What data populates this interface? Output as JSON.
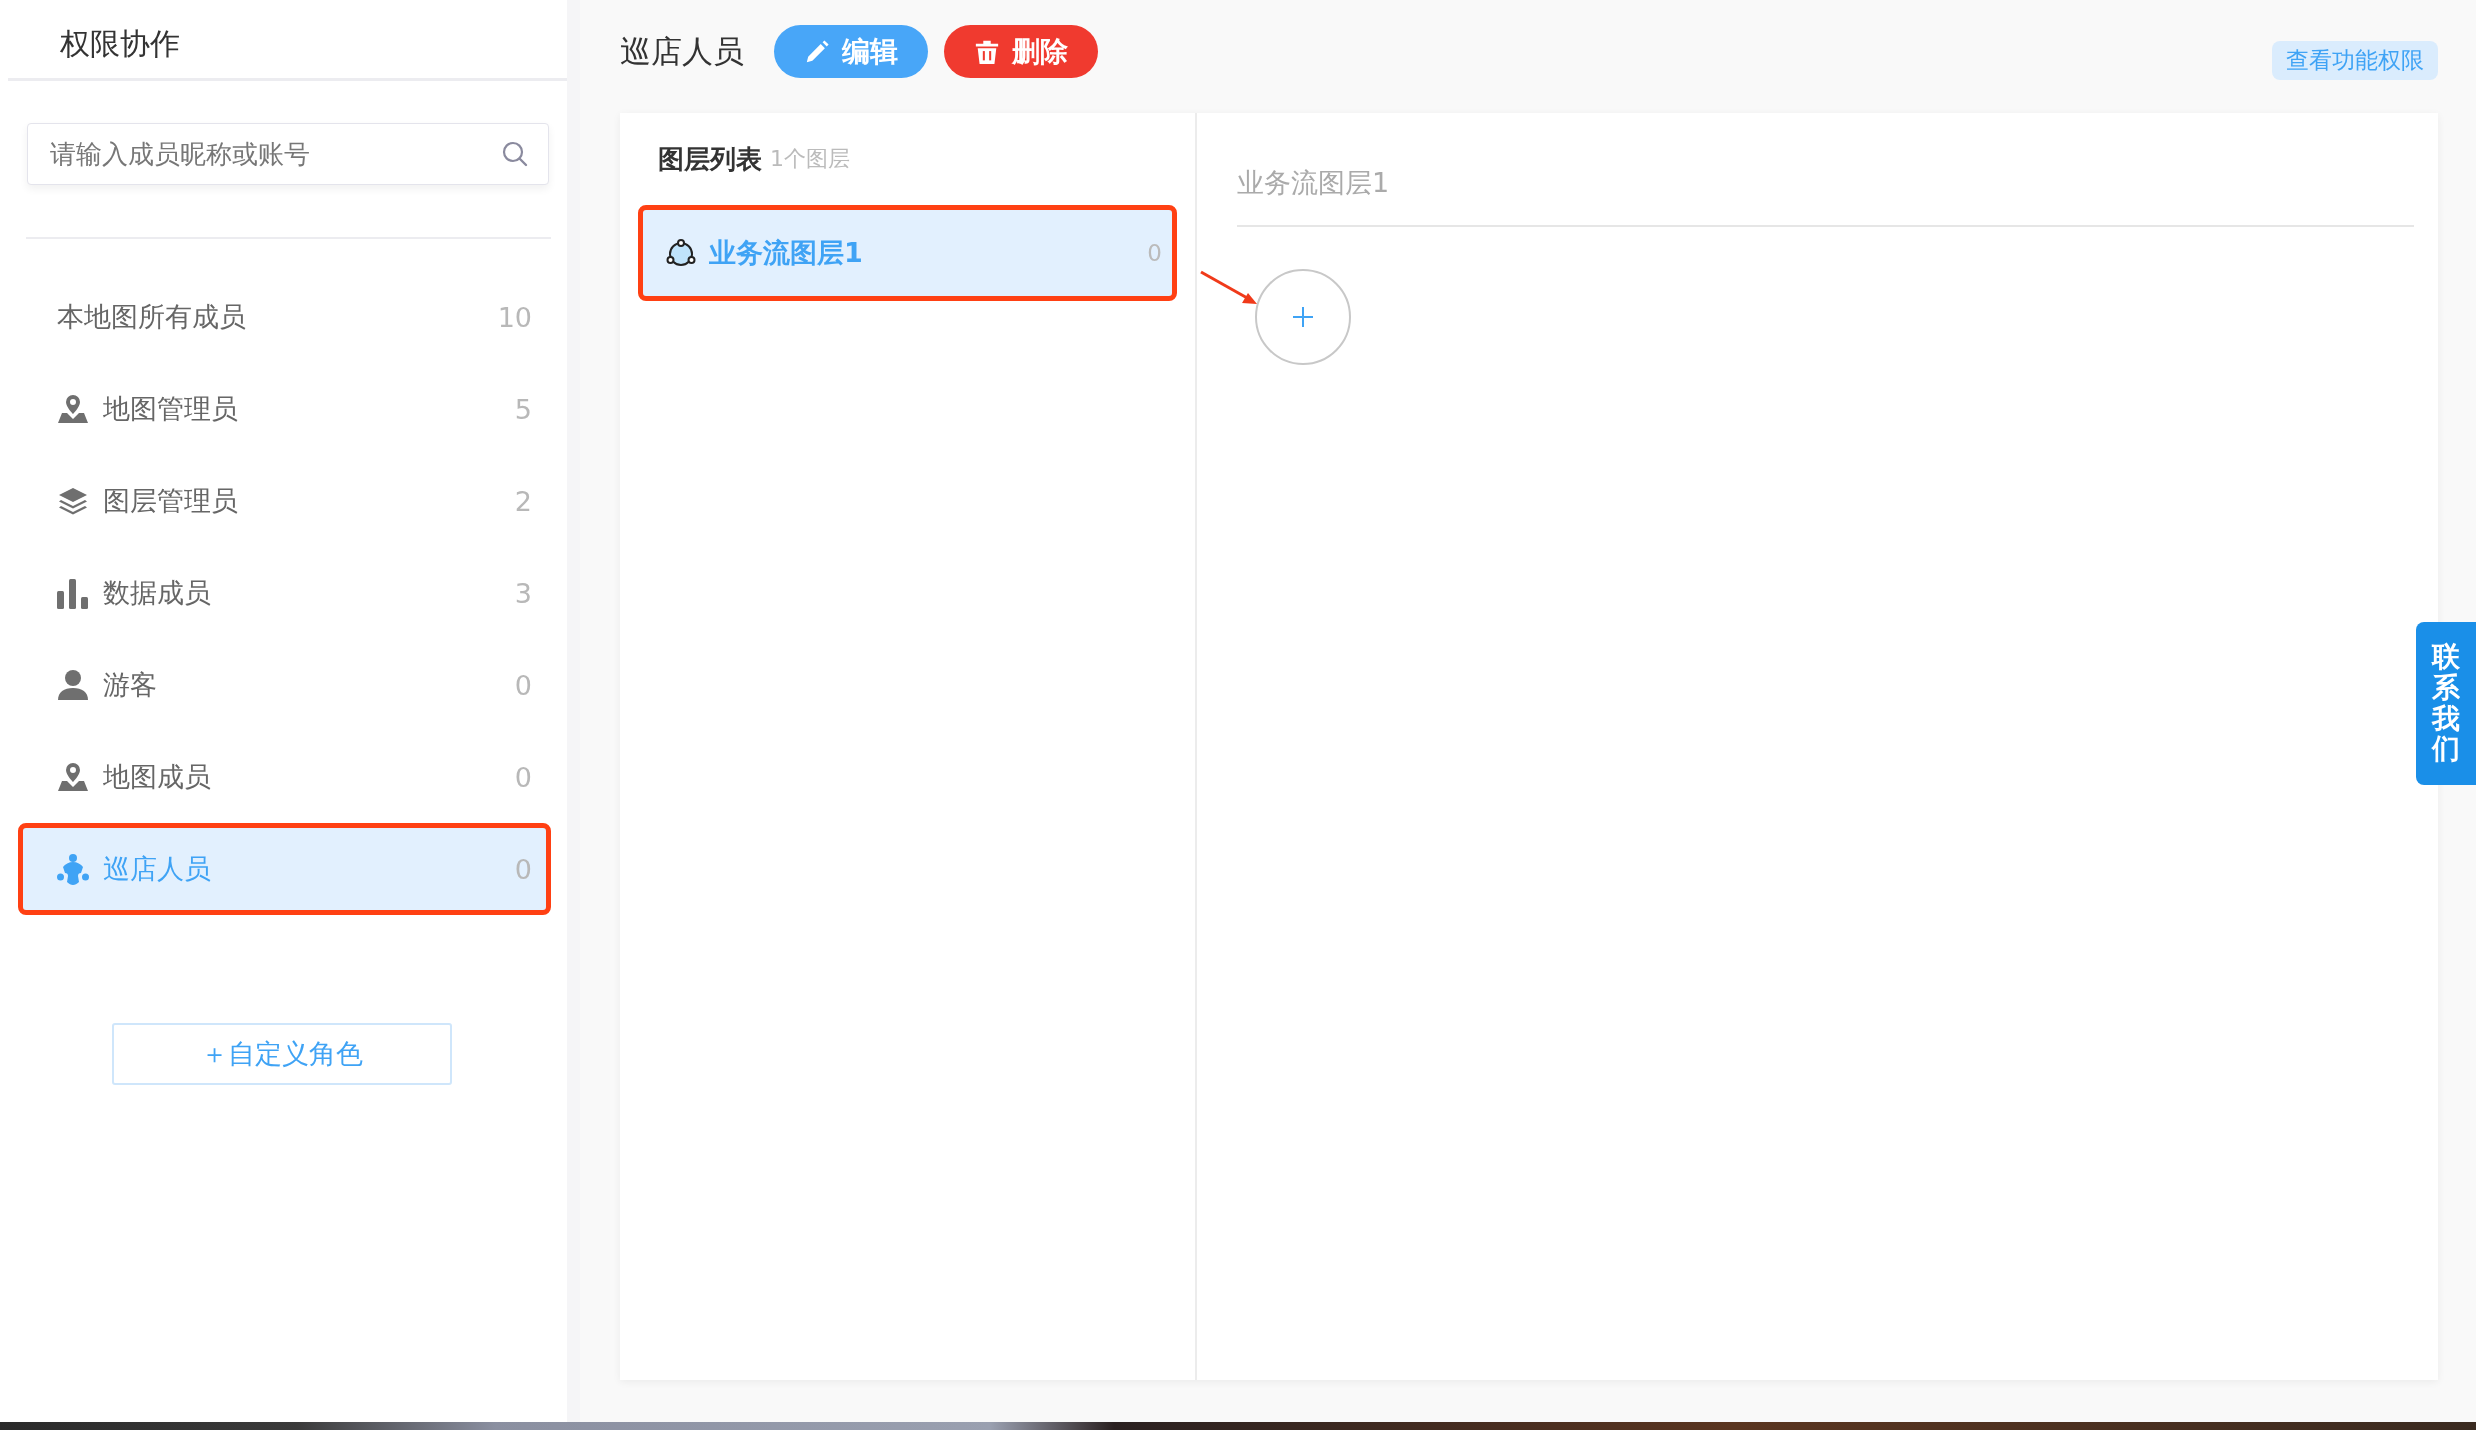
{
  "sidebar": {
    "title": "权限协作",
    "search": {
      "placeholder": "请输入成员昵称或账号"
    },
    "items": [
      {
        "kind": "plain",
        "label": "本地图所有成员",
        "count": "10",
        "selected": false,
        "highlighted": false
      },
      {
        "kind": "map-pin",
        "label": "地图管理员",
        "count": "5",
        "selected": false,
        "highlighted": false
      },
      {
        "kind": "layers",
        "label": "图层管理员",
        "count": "2",
        "selected": false,
        "highlighted": false
      },
      {
        "kind": "chart",
        "label": "数据成员",
        "count": "3",
        "selected": false,
        "highlighted": false
      },
      {
        "kind": "person",
        "label": "游客",
        "count": "0",
        "selected": false,
        "highlighted": false
      },
      {
        "kind": "map-pin",
        "label": "地图成员",
        "count": "0",
        "selected": false,
        "highlighted": false
      },
      {
        "kind": "group",
        "label": "巡店人员",
        "count": "0",
        "selected": true,
        "highlighted": true
      }
    ],
    "add_role_button": "＋自定义角色"
  },
  "header": {
    "title": "巡店人员",
    "edit_button": "编辑",
    "delete_button": "删除",
    "permissions_button": "查看功能权限"
  },
  "layer_list": {
    "title": "图层列表",
    "count": "1个图层",
    "layers": [
      {
        "label": "业务流图层1",
        "count": "0",
        "selected": true,
        "highlighted": true
      }
    ]
  },
  "detail": {
    "title": "业务流图层1"
  },
  "contact_tab": "联系我们"
}
